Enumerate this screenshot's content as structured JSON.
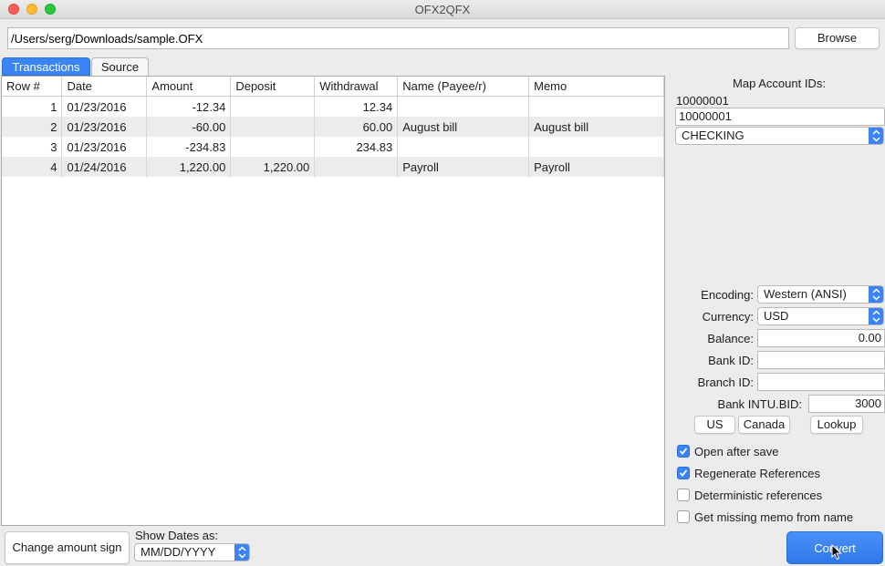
{
  "window": {
    "title": "OFX2QFX"
  },
  "colors": {
    "accent": "#3a84f5",
    "close": "#ff5f57",
    "minimize": "#febc2e",
    "zoom": "#28c840"
  },
  "file": {
    "path": "/Users/serg/Downloads/sample.OFX",
    "browse_label": "Browse"
  },
  "tabs": [
    {
      "label": "Transactions",
      "selected": true
    },
    {
      "label": "Source",
      "selected": false
    }
  ],
  "table": {
    "columns": [
      "Row #",
      "Date",
      "Amount",
      "Deposit",
      "Withdrawal",
      "Name (Payee/r)",
      "Memo"
    ],
    "rows": [
      [
        "1",
        "01/23/2016",
        "-12.34",
        "",
        "12.34",
        "",
        ""
      ],
      [
        "2",
        "01/23/2016",
        "-60.00",
        "",
        "60.00",
        "August bill",
        "August bill"
      ],
      [
        "3",
        "01/23/2016",
        "-234.83",
        "",
        "234.83",
        "",
        ""
      ],
      [
        "4",
        "01/24/2016",
        "1,220.00",
        "1,220.00",
        "",
        "Payroll",
        "Payroll"
      ]
    ]
  },
  "map": {
    "heading": "Map Account IDs:",
    "source_id": "10000001",
    "target_id": "10000001",
    "account_type": "CHECKING"
  },
  "settings": {
    "encoding_label": "Encoding:",
    "encoding": "Western (ANSI)",
    "currency_label": "Currency:",
    "currency": "USD",
    "balance_label": "Balance:",
    "balance": "0.00",
    "bank_id_label": "Bank ID:",
    "bank_id": "",
    "branch_id_label": "Branch ID:",
    "branch_id": "",
    "intu_bid_label": "Bank INTU.BID:",
    "intu_bid": "3000",
    "us_label": "US",
    "canada_label": "Canada",
    "lookup_label": "Lookup"
  },
  "options": [
    {
      "label": "Open after save",
      "checked": true
    },
    {
      "label": "Regenerate References",
      "checked": true
    },
    {
      "label": "Deterministic references",
      "checked": false
    },
    {
      "label": "Get missing memo from name",
      "checked": false
    }
  ],
  "bottom": {
    "change_sign_label": "Change amount sign",
    "show_dates_label": "Show Dates as:",
    "date_format": "MM/DD/YYYY",
    "convert_label": "Convert"
  }
}
